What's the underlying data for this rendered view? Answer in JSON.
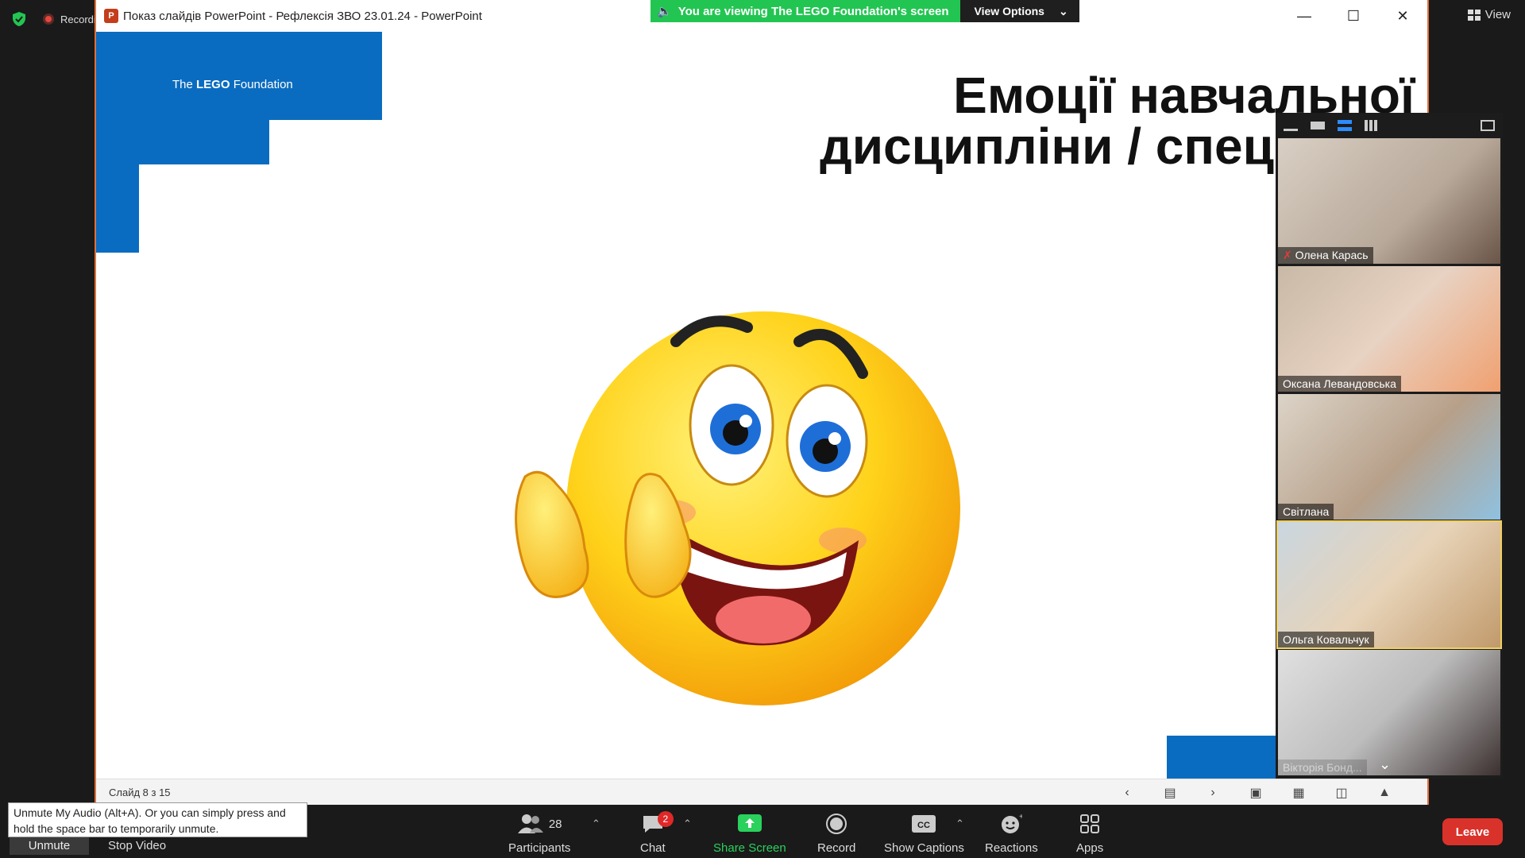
{
  "top_bar": {
    "recording_label": "Recording",
    "view_label": "View"
  },
  "banner": {
    "viewing_text": "You are viewing The LEGO Foundation's screen",
    "view_options_label": "View Options"
  },
  "window": {
    "title": "Показ слайдів PowerPoint  -  Рефлексія ЗВО 23.01.24 - PowerPoint"
  },
  "slide": {
    "logo_prefix": "The ",
    "logo_brand": "LEGO",
    "logo_suffix": " Foundation",
    "title_line1": "Емоції навчальної",
    "title_line2": "дисципліни / спецкурсу",
    "status": "Слайд 8 з 15"
  },
  "gallery": {
    "participants": [
      {
        "name": "Олена Карась",
        "muted": true
      },
      {
        "name": "Оксана Левандовська",
        "muted": false
      },
      {
        "name": "Світлана",
        "muted": false
      },
      {
        "name": "Ольга Ковальчук",
        "muted": false,
        "active_speaker": true
      },
      {
        "name": "Вікторія Бонд...",
        "muted": false
      }
    ]
  },
  "toolbar": {
    "participants_count": "28",
    "participants_label": "Participants",
    "chat_badge": "2",
    "chat_label": "Chat",
    "share_label": "Share Screen",
    "record_label": "Record",
    "captions_label": "Show Captions",
    "reactions_label": "Reactions",
    "apps_label": "Apps",
    "leave_label": "Leave",
    "unmute_label": "Unmute",
    "stop_video_label": "Stop Video"
  },
  "tooltip": {
    "text": "Unmute My Audio (Alt+A). Or you can simply press and hold the space bar to temporarily unmute."
  },
  "colors": {
    "zoom_green": "#23c552",
    "lego_blue": "#0a6cc0",
    "leave_red": "#d9322b",
    "share_border": "#e0703a"
  }
}
